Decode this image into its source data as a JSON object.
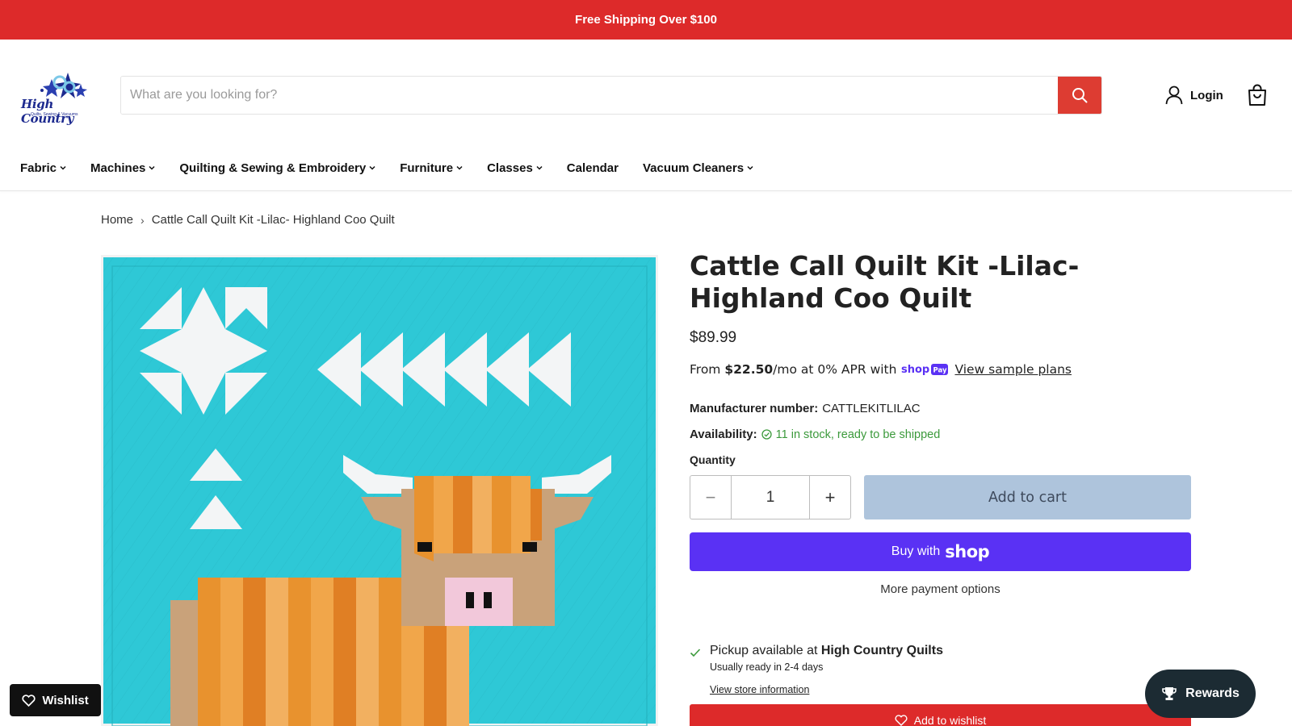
{
  "announcement": "Free Shipping Over $100",
  "logo": {
    "name": "High Country",
    "tagline": "Quilts, Sewing & Vacuums"
  },
  "search": {
    "placeholder": "What are you looking for?",
    "value": ""
  },
  "header": {
    "login_label": "Login"
  },
  "nav": {
    "items": [
      {
        "label": "Fabric",
        "has_dropdown": true
      },
      {
        "label": "Machines",
        "has_dropdown": true
      },
      {
        "label": "Quilting & Sewing & Embroidery",
        "has_dropdown": true
      },
      {
        "label": "Furniture",
        "has_dropdown": true
      },
      {
        "label": "Classes",
        "has_dropdown": true
      },
      {
        "label": "Calendar",
        "has_dropdown": false
      },
      {
        "label": "Vacuum Cleaners",
        "has_dropdown": true
      }
    ]
  },
  "breadcrumb": {
    "home": "Home",
    "separator": "›",
    "current": "Cattle Call Quilt Kit -Lilac- Highland Coo Quilt"
  },
  "product": {
    "title": "Cattle Call Quilt Kit -Lilac- Highland Coo Quilt",
    "price": "$89.99",
    "installments": {
      "prefix": "From",
      "amount": "$22.50",
      "suffix": "/mo at 0% APR with",
      "badge": "shop Pay",
      "link": "View sample plans"
    },
    "manufacturer_label": "Manufacturer number:",
    "manufacturer_value": "CATTLEKITLILAC",
    "availability_label": "Availability:",
    "availability_value": "11 in stock, ready to be shipped",
    "quantity_label": "Quantity",
    "quantity_value": "1",
    "qty_minus": "−",
    "qty_plus": "+",
    "add_to_cart": "Add to cart",
    "buy_with": "Buy with",
    "buy_with_brand": "shop",
    "more_payment": "More payment options"
  },
  "pickup": {
    "prefix": "Pickup available at",
    "store": "High Country Quilts",
    "ready": "Usually ready in 2-4 days",
    "link": "View store information"
  },
  "wishlist_button": "Add to wishlist",
  "floating": {
    "wishlist": "Wishlist",
    "rewards": "Rewards"
  },
  "colors": {
    "announcement": "#dd2a2a",
    "search_button": "#dd3c32",
    "add_to_cart": "#aec4dc",
    "shop_pay": "#5a31f4",
    "availability": "#3c9a3c",
    "rewards": "#1c2b33",
    "quilt_background": "#2ec8d6"
  }
}
